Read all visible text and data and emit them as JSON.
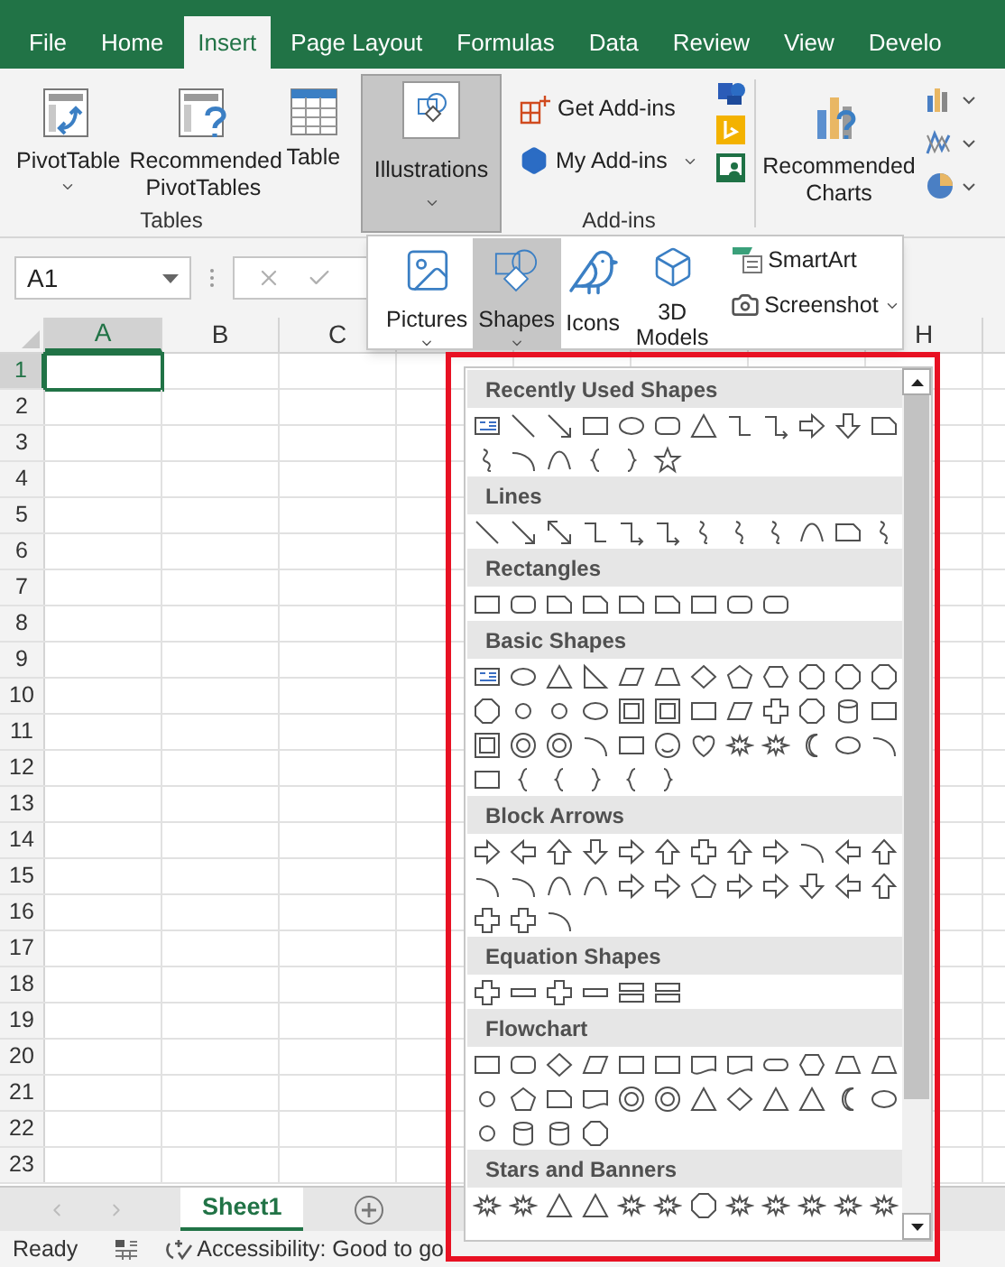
{
  "tabs": [
    {
      "label": "File",
      "selected": false
    },
    {
      "label": "Home",
      "selected": false
    },
    {
      "label": "Insert",
      "selected": true
    },
    {
      "label": "Page Layout",
      "selected": false
    },
    {
      "label": "Formulas",
      "selected": false
    },
    {
      "label": "Data",
      "selected": false
    },
    {
      "label": "Review",
      "selected": false
    },
    {
      "label": "View",
      "selected": false
    },
    {
      "label": "Develo",
      "selected": false
    }
  ],
  "tables_group": {
    "label": "Tables",
    "buttons": [
      {
        "label": "PivotTable"
      },
      {
        "label": "Recommended PivotTables"
      },
      {
        "label": "Table"
      }
    ]
  },
  "illustrations_button": {
    "label": "Illustrations",
    "pressed": true
  },
  "addins_group": {
    "label": "Add-ins",
    "buttons": [
      {
        "label": "Get Add-ins"
      },
      {
        "label": "My Add-ins"
      }
    ]
  },
  "charts_button": {
    "label": "Recommended Charts"
  },
  "name_box": {
    "value": "A1"
  },
  "columns": [
    {
      "label": "A",
      "selected": true
    },
    {
      "label": "B",
      "selected": false
    },
    {
      "label": "C",
      "selected": false
    },
    {
      "label": "H",
      "selected": false
    }
  ],
  "rows": [
    {
      "label": "1",
      "selected": true
    },
    {
      "label": "2",
      "selected": false
    },
    {
      "label": "3",
      "selected": false
    },
    {
      "label": "4",
      "selected": false
    },
    {
      "label": "5",
      "selected": false
    },
    {
      "label": "6",
      "selected": false
    },
    {
      "label": "7",
      "selected": false
    },
    {
      "label": "8",
      "selected": false
    },
    {
      "label": "9",
      "selected": false
    },
    {
      "label": "10",
      "selected": false
    },
    {
      "label": "11",
      "selected": false
    },
    {
      "label": "12",
      "selected": false
    },
    {
      "label": "13",
      "selected": false
    },
    {
      "label": "14",
      "selected": false
    },
    {
      "label": "15",
      "selected": false
    },
    {
      "label": "16",
      "selected": false
    },
    {
      "label": "17",
      "selected": false
    },
    {
      "label": "18",
      "selected": false
    },
    {
      "label": "19",
      "selected": false
    },
    {
      "label": "20",
      "selected": false
    },
    {
      "label": "21",
      "selected": false
    },
    {
      "label": "22",
      "selected": false
    },
    {
      "label": "23",
      "selected": false
    }
  ],
  "illustrations_menu": {
    "items": [
      {
        "label": "Pictures",
        "selected": false
      },
      {
        "label": "Shapes",
        "selected": true
      },
      {
        "label": "Icons",
        "selected": false
      },
      {
        "label": "3D Models",
        "selected": false
      }
    ],
    "small_items": [
      {
        "label": "SmartArt"
      },
      {
        "label": "Screenshot"
      }
    ]
  },
  "shapes_gallery": {
    "sections": [
      {
        "title": "Recently Used Shapes"
      },
      {
        "title": "Lines"
      },
      {
        "title": "Rectangles"
      },
      {
        "title": "Basic Shapes"
      },
      {
        "title": "Block Arrows"
      },
      {
        "title": "Equation Shapes"
      },
      {
        "title": "Flowchart"
      },
      {
        "title": "Stars and Banners"
      }
    ]
  },
  "highlight_frame": true,
  "sheet_tabs": [
    {
      "label": "Sheet1",
      "selected": true
    }
  ],
  "status_bar": {
    "ready": "Ready",
    "accessibility": "Accessibility: Good to go"
  }
}
